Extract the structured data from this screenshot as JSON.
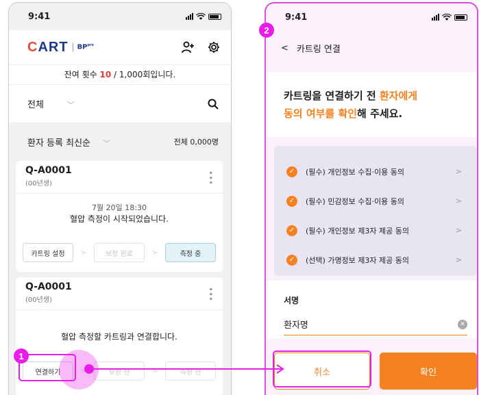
{
  "status": {
    "time": "9:41"
  },
  "left": {
    "logo": {
      "brand": "ART",
      "brand_first": "C",
      "sub": "BP",
      "sub_sup": "pro"
    },
    "remaining": {
      "prefix": "잔여 횟수 ",
      "count": "10",
      "suffix": " / 1,000회입니다."
    },
    "filter": {
      "label": "전체"
    },
    "sort": {
      "label": "환자 등록 최신순",
      "total": "전체 0,000명"
    },
    "cards": [
      {
        "id": "Q-A0001",
        "sub": "(00년생)",
        "time": "7월 20일 18:30",
        "message": "혈압 측정이 시작되었습니다.",
        "steps": [
          "카트링 설정",
          "보정 완료",
          "측정 중"
        ]
      },
      {
        "id": "Q-A0001",
        "sub": "(00년생)",
        "message": "혈압 측정할 카트링과 연결합니다.",
        "steps": [
          "연결하기",
          "보정 전",
          "측정 전"
        ]
      }
    ]
  },
  "right": {
    "header_title": "카트링 연결",
    "title": {
      "line1_a": "카트링을 연결하기 전 ",
      "line1_b": "환자에게",
      "line2_a": "동의 여부를 확인",
      "line2_b": "해 주세요."
    },
    "agreements": [
      "(필수) 개인정보 수집·이용 동의",
      "(필수) 민감정보 수집·이용 동의",
      "(필수) 개인정보 제3자 제공 동의",
      "(선택) 가명정보 제3자 제공 동의"
    ],
    "signature": {
      "label": "서명",
      "value": "환자명"
    },
    "buttons": {
      "cancel": "취소",
      "confirm": "확인"
    }
  },
  "annotations": {
    "step1": "1",
    "step2": "2"
  },
  "colors": {
    "accent": "#f58220",
    "annotation": "#e81ee8",
    "brand": "#1e3a8a",
    "alert": "#e53935"
  }
}
